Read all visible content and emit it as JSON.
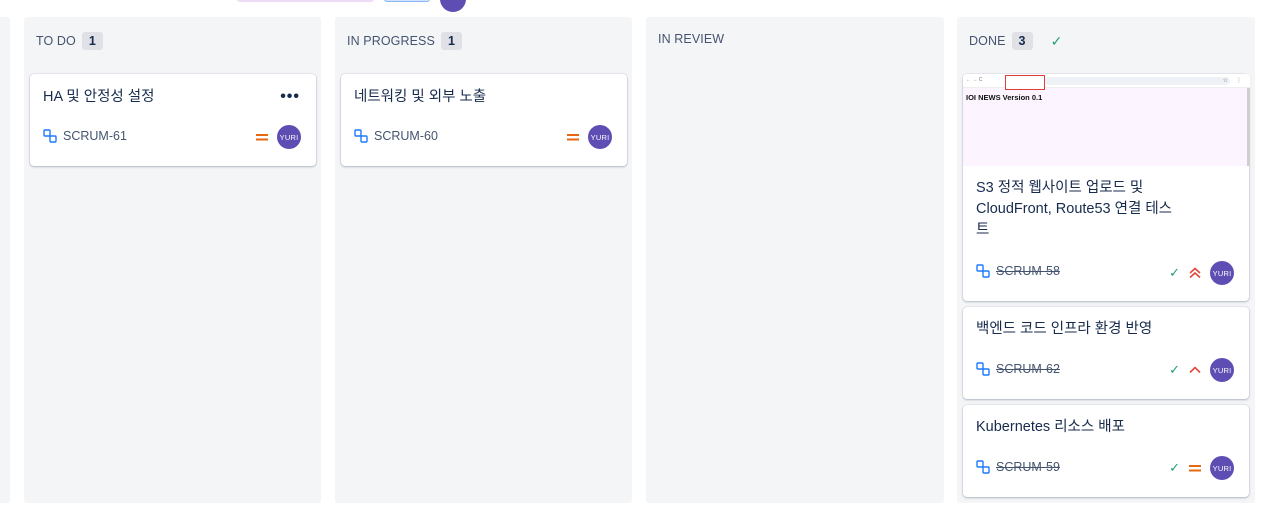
{
  "columns": [
    {
      "id": "todo",
      "title": "TO DO",
      "count": "1"
    },
    {
      "id": "inprogress",
      "title": "IN PROGRESS",
      "count": "1"
    },
    {
      "id": "inreview",
      "title": "IN REVIEW"
    },
    {
      "id": "done",
      "title": "DONE",
      "count": "3"
    }
  ],
  "cards": {
    "todo_1": {
      "title": "HA 및 안정성 설정",
      "key": "SCRUM-61",
      "priority": "medium",
      "assignee": "YURI"
    },
    "inprogress_1": {
      "title": "네트워킹 및 외부 노출",
      "key": "SCRUM-60",
      "priority": "medium",
      "assignee": "YURI"
    },
    "done_1": {
      "title": "S3 정적 웹사이트 업로드 및 CloudFront, Route53 연결 테스트",
      "title_lines": [
        "S3 정적 웹사이트 업로드 및",
        "CloudFront, Route53 연결 테스",
        "트"
      ],
      "key": "SCRUM-58",
      "priority": "highest",
      "assignee": "YURI",
      "thumbnail": {
        "page_text": "IOI NEWS Version 0.1"
      }
    },
    "done_2": {
      "title": "백엔드 코드 인프라 환경 반영",
      "key": "SCRUM-62",
      "priority": "high",
      "assignee": "YURI"
    },
    "done_3": {
      "title": "Kubernetes 리소스 배포",
      "key": "SCRUM-59",
      "priority": "medium",
      "assignee": "YURI"
    }
  },
  "icons": {
    "more": "more-horizontal-icon",
    "subtask": "subtask-icon",
    "done_check": "check-icon",
    "priority_medium": "priority-medium-icon",
    "priority_high": "priority-high-icon",
    "priority_highest": "priority-highest-icon"
  },
  "colors": {
    "column_bg": "#f4f5f7",
    "avatar": "#5e4db2",
    "priority_medium": "#e56910",
    "priority_high": "#e2483d",
    "done_green": "#22a06b",
    "subtask_blue": "#1d7afc"
  }
}
